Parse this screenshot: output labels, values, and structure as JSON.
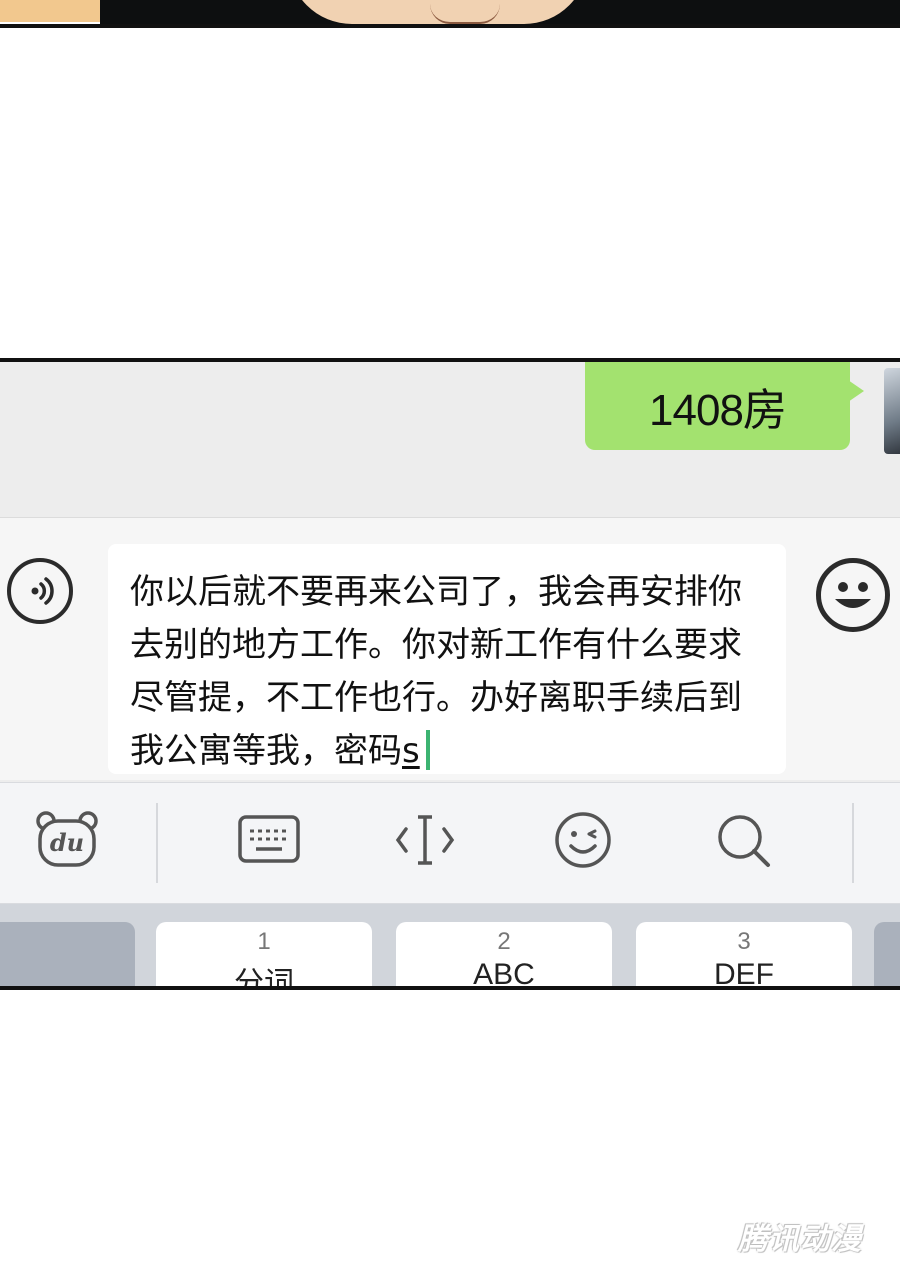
{
  "chat": {
    "sent_message": "1408房"
  },
  "input": {
    "text": "你以后就不要再来公司了，我会再安排你去别的地方工作。你对新工作有什么要求尽管提，不工作也行。办好离职手续后到我公寓等我，密码",
    "composing": "s"
  },
  "toolbar": {
    "icons": [
      "baidu-du-icon",
      "keyboard-icon",
      "cursor-icon",
      "emoji-face-icon",
      "search-icon"
    ],
    "du_label": "du"
  },
  "keyboard": {
    "keys": [
      {
        "num": "1",
        "letters": "分词"
      },
      {
        "num": "2",
        "letters": "ABC"
      },
      {
        "num": "3",
        "letters": "DEF"
      }
    ]
  },
  "watermark": "腾讯动漫",
  "colors": {
    "sent_bubble": "#a3e26f",
    "caret": "#3cb371",
    "chat_background": "#ededed"
  }
}
